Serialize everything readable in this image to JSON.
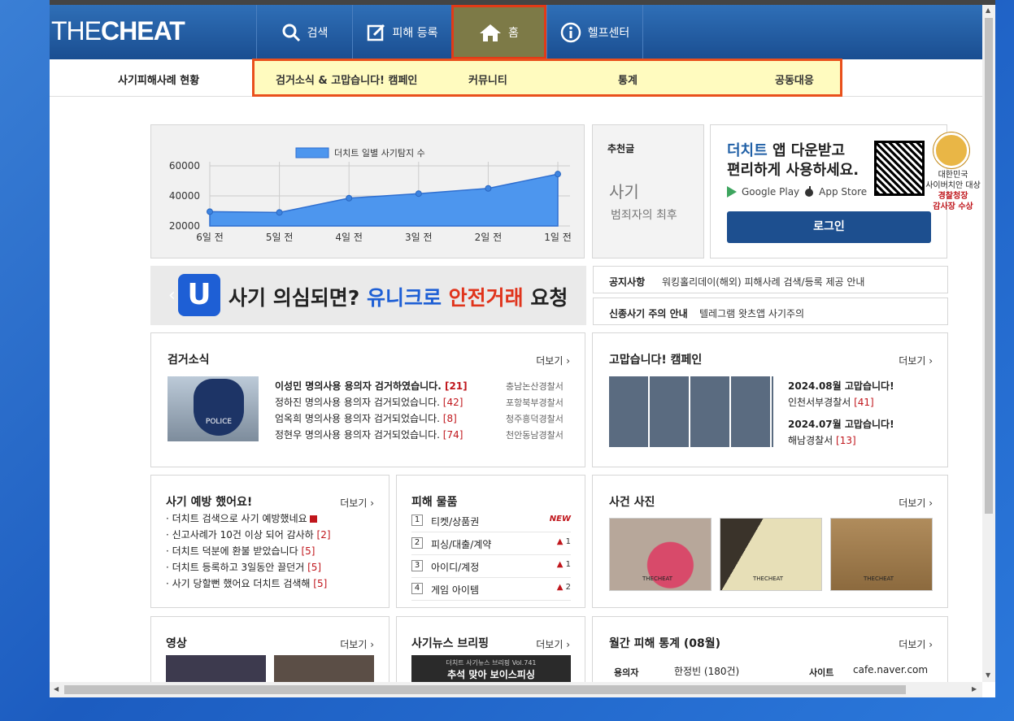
{
  "header": {
    "logo": "THECHEAT",
    "nav": [
      {
        "label": "검색",
        "icon": "search-icon"
      },
      {
        "label": "피해 등록",
        "icon": "edit-icon"
      },
      {
        "label": "홈",
        "icon": "home-icon"
      },
      {
        "label": "헬프센터",
        "icon": "info-icon"
      }
    ]
  },
  "subnav": {
    "first": "사기피해사례 현황",
    "items": [
      "검거소식 & 고맙습니다! 캠페인",
      "커뮤니티",
      "통계",
      "공동대응"
    ]
  },
  "chart_data": {
    "type": "area",
    "legend": "더치트 일별 사기탐지 수",
    "categories": [
      "6일 전",
      "5일 전",
      "4일 전",
      "3일 전",
      "2일 전",
      "1일 전"
    ],
    "values": [
      29500,
      29000,
      38500,
      41500,
      45000,
      54500
    ],
    "yticks": [
      "60000",
      "40000",
      "20000"
    ],
    "ylim": [
      20000,
      60000
    ]
  },
  "recommend": {
    "title": "추천글",
    "line1": "사기",
    "line2": "범죄자의 최후"
  },
  "app": {
    "hl": "더치트",
    "l1": " 앱 다운받고",
    "l2": "편리하게 사용하세요.",
    "gp": "Google Play",
    "as": "App Store",
    "login": "로그인",
    "award1": "대한민국",
    "award2": "사이버치안 대상",
    "award3": "경찰청장",
    "award4": "감사장 수상"
  },
  "banner": {
    "u": "U",
    "t1": "사기 의심되면?",
    "t2": "유니크로",
    "t3": "안전거래",
    "t4": "요청"
  },
  "notice": [
    {
      "label": "공지사항",
      "text": "워킹홀리데이(해외) 피해사례 검색/등록 제공 안내"
    },
    {
      "label": "신종사기 주의 안내",
      "text": "텔레그램 왓츠앱 사기주의"
    }
  ],
  "arrest": {
    "title": "검거소식",
    "more": "더보기",
    "items": [
      {
        "t": "이성민 명의사용 용의자 검거하였습니다.",
        "c": "[21]",
        "s": "충남논산경찰서"
      },
      {
        "t": "정하진 명의사용 용의자 검거되었습니다.",
        "c": "[42]",
        "s": "포항북부경찰서"
      },
      {
        "t": "엄옥희 명의사용 용의자 검거되었습니다.",
        "c": "[8]",
        "s": "청주흥덕경찰서"
      },
      {
        "t": "정현우 명의사용 용의자 검거되었습니다.",
        "c": "[74]",
        "s": "천안동남경찰서"
      }
    ]
  },
  "thanks": {
    "title": "고맙습니다! 캠페인",
    "more": "더보기",
    "items": [
      {
        "m": "2024.08월",
        "t": "고맙습니다!",
        "s": "인천서부경찰서",
        "c": "[41]"
      },
      {
        "m": "2024.07월",
        "t": "고맙습니다!",
        "s": "해남경찰서",
        "c": "[13]"
      }
    ]
  },
  "prevent": {
    "title": "사기 예방 했어요!",
    "more": "더보기",
    "items": [
      {
        "t": "더치트 검색으로 사기 예방했네요",
        "c": ""
      },
      {
        "t": "신고사례가 10건 이상 되어 감사하",
        "c": "[2]"
      },
      {
        "t": "더치트 덕분에 환불 받았습니다",
        "c": "[5]"
      },
      {
        "t": "더치트 등록하고 3일동안 끌던거",
        "c": "[5]"
      },
      {
        "t": "사기 당할뻔 했어요 더치트 검색해",
        "c": "[5]"
      }
    ]
  },
  "damage": {
    "title": "피해 물품",
    "items": [
      {
        "n": "1",
        "t": "티켓/상품권",
        "tag": "NEW"
      },
      {
        "n": "2",
        "t": "피싱/대출/계약",
        "tag": "1"
      },
      {
        "n": "3",
        "t": "아이디/계정",
        "tag": "1"
      },
      {
        "n": "4",
        "t": "게임 아이템",
        "tag": "2"
      }
    ]
  },
  "photos": {
    "title": "사건 사진",
    "more": "더보기",
    "wm": "THECHEAT"
  },
  "video": {
    "title": "영상",
    "more": "더보기"
  },
  "news": {
    "title": "사기뉴스 브리핑",
    "more": "더보기",
    "sub": "더치트 사기뉴스 브리핑 Vol.741",
    "head": "추석 맞아 보이스피싱"
  },
  "stats": {
    "title": "월간 피해 통계 (08월)",
    "more": "더보기",
    "k1": "용의자",
    "v1": "한정빈 (180건)",
    "k2": "사이트",
    "v2": "cafe.naver.com"
  },
  "police": {
    "badge": "POLICE"
  }
}
